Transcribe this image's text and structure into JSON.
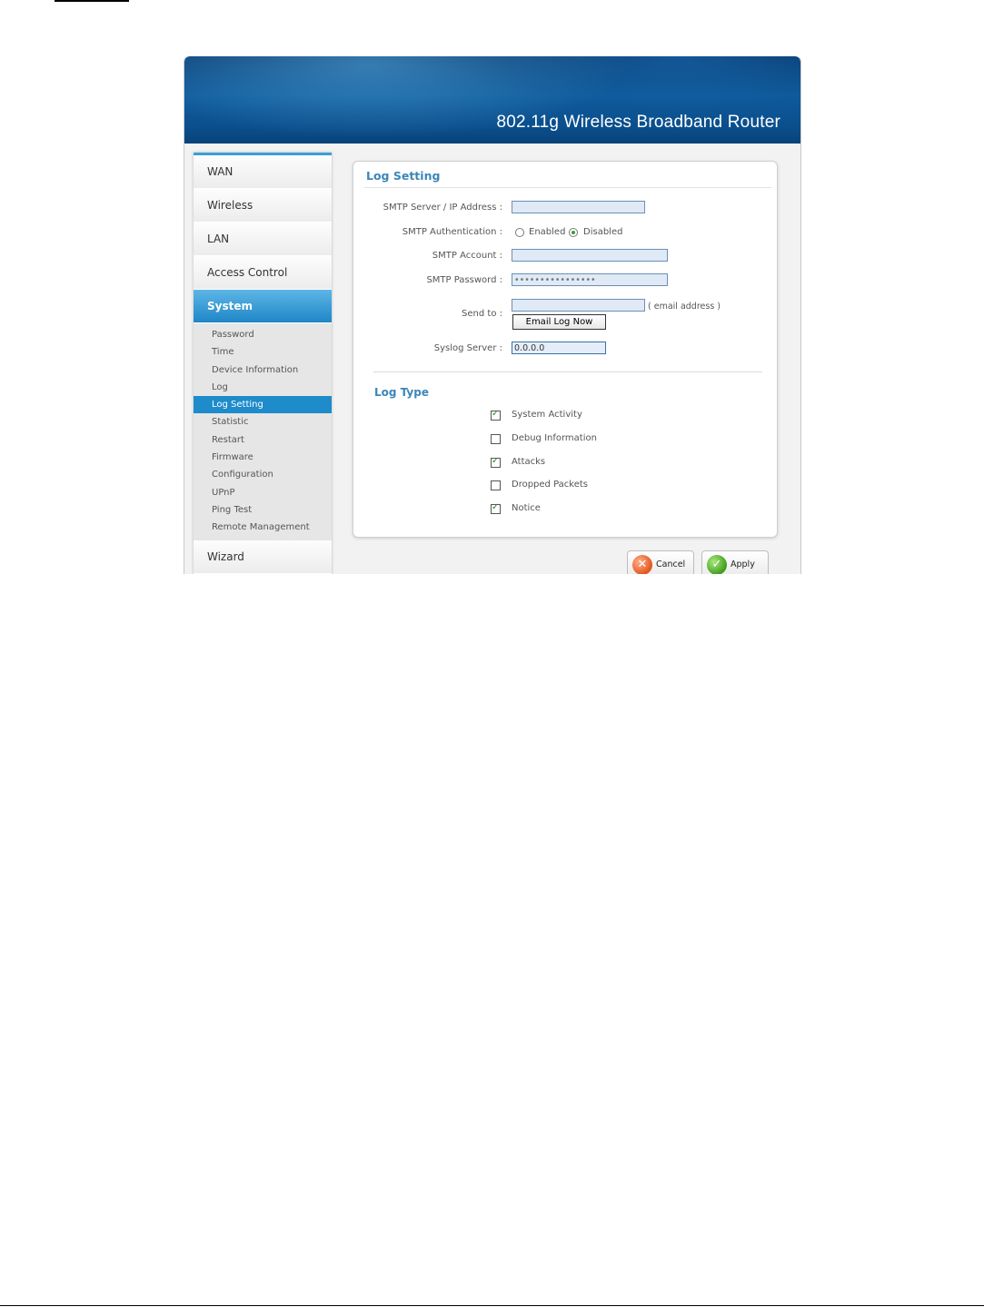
{
  "header": {
    "title": "802.11g Wireless Broadband Router"
  },
  "sidebar": {
    "main_top": [
      {
        "label": "WAN"
      },
      {
        "label": "Wireless"
      },
      {
        "label": "LAN"
      },
      {
        "label": "Access Control"
      },
      {
        "label": "System",
        "active": true
      }
    ],
    "submenu": [
      {
        "label": "Password"
      },
      {
        "label": "Time"
      },
      {
        "label": "Device Information"
      },
      {
        "label": "Log"
      },
      {
        "label": "Log Setting",
        "active": true
      },
      {
        "label": "Statistic"
      },
      {
        "label": "Restart"
      },
      {
        "label": "Firmware"
      },
      {
        "label": "Configuration"
      },
      {
        "label": "UPnP"
      },
      {
        "label": "Ping Test"
      },
      {
        "label": "Remote Management"
      }
    ],
    "main_bottom": [
      {
        "label": "Wizard"
      }
    ]
  },
  "panel": {
    "title": "Log Setting",
    "smtp_server": {
      "label": "SMTP Server / IP Address :",
      "value": ""
    },
    "smtp_auth": {
      "label": "SMTP Authentication :",
      "enabled_label": "Enabled",
      "disabled_label": "Disabled",
      "selected": "Disabled"
    },
    "smtp_account": {
      "label": "SMTP Account :",
      "value": ""
    },
    "smtp_password": {
      "label": "SMTP Password :",
      "value": "••••••••••••••••"
    },
    "send_to": {
      "label": "Send to :",
      "value": "",
      "hint": "( email address )"
    },
    "email_log_now": "Email Log Now",
    "syslog": {
      "label": "Syslog Server :",
      "value": "0.0.0.0"
    },
    "log_type": {
      "title": "Log Type",
      "items": [
        {
          "label": "System Activity",
          "checked": true
        },
        {
          "label": "Debug Information",
          "checked": false
        },
        {
          "label": "Attacks",
          "checked": true
        },
        {
          "label": "Dropped Packets",
          "checked": false
        },
        {
          "label": "Notice",
          "checked": true
        }
      ]
    }
  },
  "buttons": {
    "cancel": "Cancel",
    "apply": "Apply"
  },
  "colors": {
    "accent": "#1e8bcb",
    "heading": "#3c86b8",
    "banner": "#0e5a9b"
  }
}
